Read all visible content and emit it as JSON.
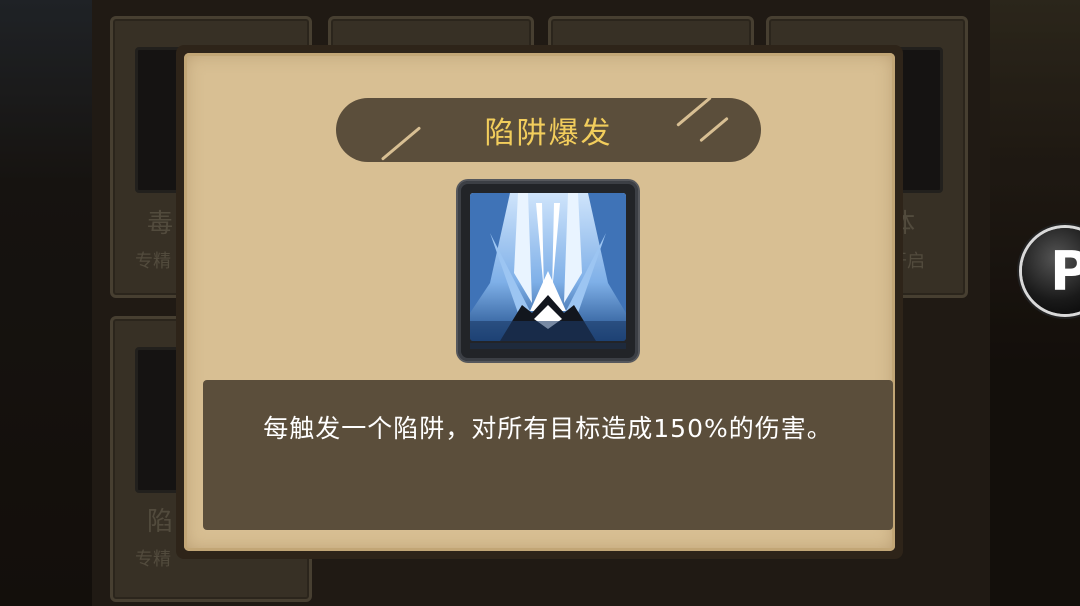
{
  "popup": {
    "title": "陷阱爆发",
    "icon": "ice-spike-icon",
    "description": "每触发一个陷阱，对所有目标造成150%的伤害。"
  },
  "background_cards": [
    {
      "name": "毒",
      "sub": "专精"
    },
    {
      "name": "体",
      "sub": "开启"
    },
    {
      "name": "陷",
      "sub": "专精"
    }
  ],
  "float_button": {
    "glyph": "P"
  },
  "colors": {
    "paper": "#d8bf93",
    "banner": "#5b4e3b",
    "title_gold": "#f2cd5c",
    "frame": "#2e2419"
  }
}
